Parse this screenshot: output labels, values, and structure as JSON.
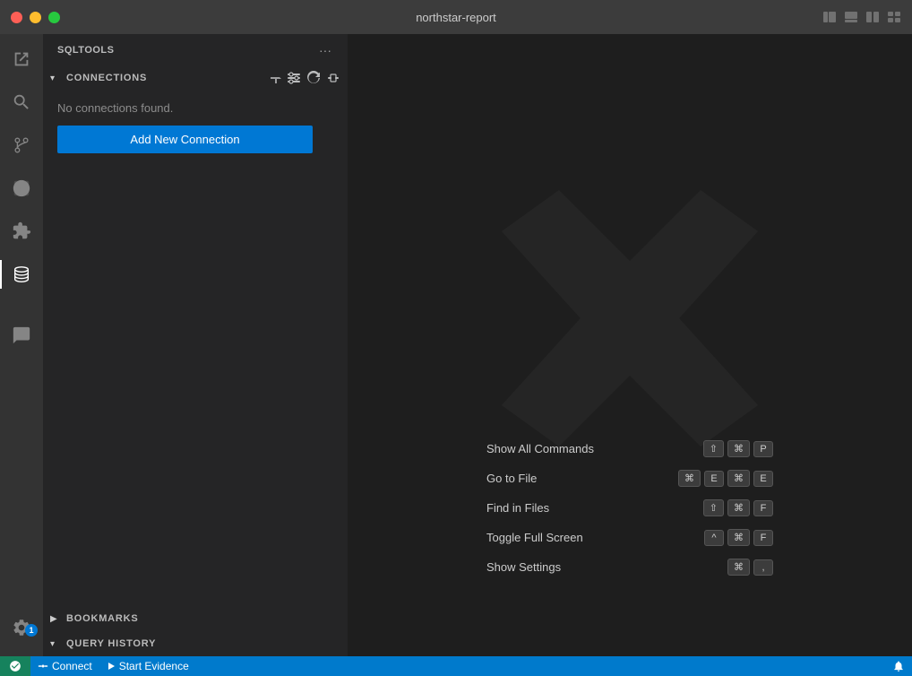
{
  "titleBar": {
    "title": "northstar-report",
    "buttons": {
      "close": "⬤",
      "minimize": "⬤",
      "maximize": "⬤"
    }
  },
  "activityBar": {
    "items": [
      {
        "name": "explorer",
        "icon": "files",
        "active": false
      },
      {
        "name": "search",
        "icon": "search",
        "active": false
      },
      {
        "name": "source-control",
        "icon": "git",
        "active": false
      },
      {
        "name": "run-debug",
        "icon": "run",
        "active": false
      },
      {
        "name": "extensions",
        "icon": "extensions",
        "active": false
      },
      {
        "name": "database",
        "icon": "database",
        "active": true
      }
    ],
    "bottomItems": [
      {
        "name": "settings",
        "icon": "gear",
        "badge": "1"
      }
    ]
  },
  "sidebar": {
    "header": "SQLTOOLS",
    "moreIcon": "···",
    "connections": {
      "sectionLabel": "CONNECTIONS",
      "collapsed": false,
      "noConnectionsText": "No connections found.",
      "addButtonLabel": "Add New Connection",
      "toolbarIcons": [
        "new-connection",
        "new-connection-from-settings",
        "refresh",
        "disconnect-all"
      ]
    },
    "bookmarks": {
      "sectionLabel": "BOOKMARKS",
      "collapsed": true
    },
    "queryHistory": {
      "sectionLabel": "QUERY HISTORY",
      "collapsed": false
    }
  },
  "editor": {
    "shortcuts": [
      {
        "label": "Show All Commands",
        "keys": [
          "⇧",
          "⌘",
          "P"
        ]
      },
      {
        "label": "Go to File",
        "keys": [
          "⌘",
          "E",
          "⌘",
          "E"
        ]
      },
      {
        "label": "Find in Files",
        "keys": [
          "⇧",
          "⌘",
          "F"
        ]
      },
      {
        "label": "Toggle Full Screen",
        "keys": [
          "^",
          "⌘",
          "F"
        ]
      },
      {
        "label": "Show Settings",
        "keys": [
          "⌘",
          ","
        ]
      }
    ]
  },
  "statusBar": {
    "connectLabel": "Connect",
    "startEvidenceLabel": "Start Evidence",
    "rightIcon": "remote"
  }
}
